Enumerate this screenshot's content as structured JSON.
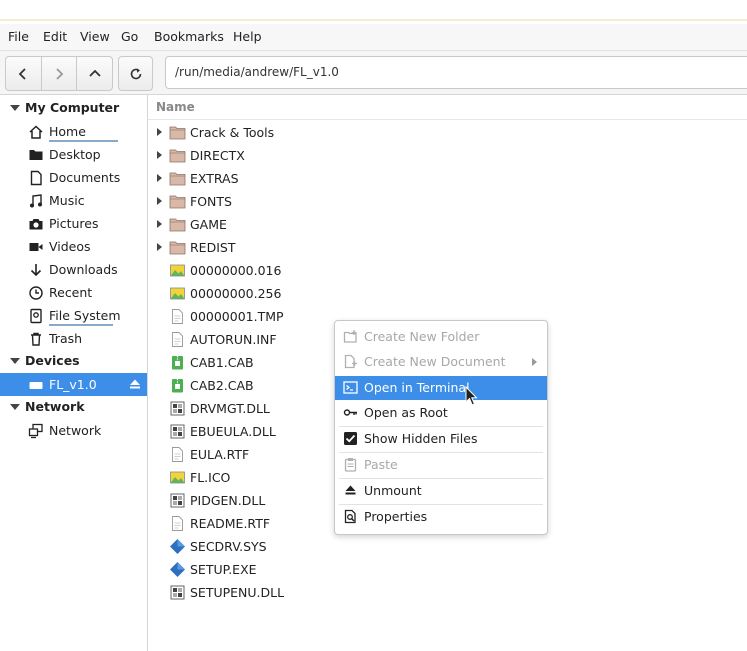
{
  "menubar": {
    "items": [
      "File",
      "Edit",
      "View",
      "Go",
      "Bookmarks",
      "Help"
    ]
  },
  "toolbar": {
    "path": "/run/media/andrew/FL_v1.0"
  },
  "sidebar": {
    "sections": [
      {
        "title": "My Computer",
        "items": [
          {
            "label": "Home",
            "icon": "home-icon"
          },
          {
            "label": "Desktop",
            "icon": "desktop-icon"
          },
          {
            "label": "Documents",
            "icon": "document-icon"
          },
          {
            "label": "Music",
            "icon": "music-icon"
          },
          {
            "label": "Pictures",
            "icon": "camera-icon"
          },
          {
            "label": "Videos",
            "icon": "video-icon"
          },
          {
            "label": "Downloads",
            "icon": "download-icon"
          },
          {
            "label": "Recent",
            "icon": "clock-icon"
          },
          {
            "label": "File System",
            "icon": "drive-icon"
          },
          {
            "label": "Trash",
            "icon": "trash-icon"
          }
        ]
      },
      {
        "title": "Devices",
        "items": [
          {
            "label": "FL_v1.0",
            "icon": "usb-drive-icon"
          }
        ]
      },
      {
        "title": "Network",
        "items": [
          {
            "label": "Network",
            "icon": "network-icon"
          }
        ]
      }
    ]
  },
  "files": {
    "header": "Name",
    "rows": [
      {
        "name": "Crack & Tools",
        "icon": "folder-icon"
      },
      {
        "name": "DIRECTX",
        "icon": "folder-icon"
      },
      {
        "name": "EXTRAS",
        "icon": "folder-icon"
      },
      {
        "name": "FONTS",
        "icon": "folder-icon"
      },
      {
        "name": "GAME",
        "icon": "folder-icon"
      },
      {
        "name": "REDIST",
        "icon": "folder-icon"
      },
      {
        "name": "00000000.016",
        "icon": "image-file-icon"
      },
      {
        "name": "00000000.256",
        "icon": "image-file-icon"
      },
      {
        "name": "00000001.TMP",
        "icon": "text-file-icon"
      },
      {
        "name": "AUTORUN.INF",
        "icon": "text-file-icon"
      },
      {
        "name": "CAB1.CAB",
        "icon": "archive-file-icon"
      },
      {
        "name": "CAB2.CAB",
        "icon": "archive-file-icon"
      },
      {
        "name": "DRVMGT.DLL",
        "icon": "binary-file-icon"
      },
      {
        "name": "EBUEULA.DLL",
        "icon": "binary-file-icon"
      },
      {
        "name": "EULA.RTF",
        "icon": "text-file-icon"
      },
      {
        "name": "FL.ICO",
        "icon": "image-file-icon"
      },
      {
        "name": "PIDGEN.DLL",
        "icon": "binary-file-icon"
      },
      {
        "name": "README.RTF",
        "icon": "text-file-icon"
      },
      {
        "name": "SECDRV.SYS",
        "icon": "exe-file-icon"
      },
      {
        "name": "SETUP.EXE",
        "icon": "exe-file-icon"
      },
      {
        "name": "SETUPENU.DLL",
        "icon": "binary-file-icon"
      }
    ]
  },
  "context_menu": {
    "items": [
      {
        "label": "Create New Folder",
        "icon": "new-folder-icon",
        "state": "disabled"
      },
      {
        "label": "Create New Document",
        "icon": "new-document-icon",
        "state": "disabled"
      },
      {
        "label": "Open in Terminal",
        "icon": "terminal-icon",
        "state": "highlighted"
      },
      {
        "label": "Open as Root",
        "icon": "key-icon",
        "state": "enabled"
      },
      {
        "label": "Show Hidden Files",
        "icon": "checkbox-checked-icon",
        "state": "enabled"
      },
      {
        "label": "Paste",
        "icon": "paste-icon",
        "state": "disabled"
      },
      {
        "label": "Unmount",
        "icon": "eject-icon",
        "state": "enabled"
      },
      {
        "label": "Properties",
        "icon": "properties-icon",
        "state": "enabled"
      }
    ]
  },
  "colors": {
    "accent": "#3d8ee8",
    "folder": "#d9b8a8"
  }
}
